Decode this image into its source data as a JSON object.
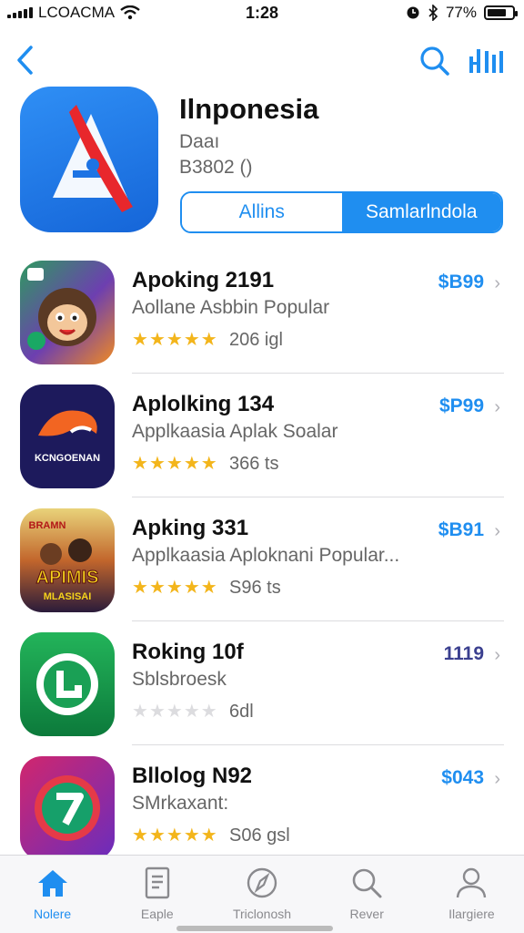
{
  "status_bar": {
    "carrier": "LCOACMA",
    "time": "1:28",
    "battery": "77%",
    "battery_level": 0.77
  },
  "nav": {
    "back_icon": "chevron-left-icon",
    "search_icon": "search-icon",
    "chart_icon": "bar-chart-icon"
  },
  "header": {
    "title": "Ilnponesia",
    "subtitle": "Daaı",
    "meta": "B3802 ()",
    "segments": [
      {
        "label": "Allins",
        "active": false
      },
      {
        "label": "Samlarlndola",
        "active": true
      }
    ]
  },
  "apps": [
    {
      "name": "Apoking 2191",
      "desc": "Aollane Asbbin Popular",
      "rating": 5,
      "count": "206 igl",
      "price": "$B99"
    },
    {
      "name": "Aplolking 134",
      "desc": "Applkaasia Aplak Soalar",
      "rating": 4.5,
      "count": "366 ts",
      "price": "$P99"
    },
    {
      "name": "Apking 331",
      "desc": "Applkaasia Aploknani Popular...",
      "rating": 5,
      "count": "S96 ts",
      "price": "$B91"
    },
    {
      "name": "Roking 10f",
      "desc": "Sblsbroesk",
      "rating": 0,
      "count": "6dl",
      "price": "1119"
    },
    {
      "name": "Bllolog N92",
      "desc": "SMrkaxant:",
      "rating": 5,
      "count": "S06 gsl",
      "price": "$043"
    }
  ],
  "icon_texts": {
    "app2": "KCNGOENAN",
    "app3_top": "BRAMN",
    "app3_mid": "APIMIS",
    "app3_bottom": "MLASISAI"
  },
  "tabs": [
    {
      "label": "Nolere",
      "icon": "home-icon",
      "active": true
    },
    {
      "label": "Eaple",
      "icon": "document-icon",
      "active": false
    },
    {
      "label": "Triclonosh",
      "icon": "compass-icon",
      "active": false
    },
    {
      "label": "Rever",
      "icon": "search-icon",
      "active": false
    },
    {
      "label": "Ilargiere",
      "icon": "person-icon",
      "active": false
    }
  ],
  "colors": {
    "accent": "#1f8ef0",
    "star": "#f3b51b",
    "header_icon": "#1e74e4"
  }
}
